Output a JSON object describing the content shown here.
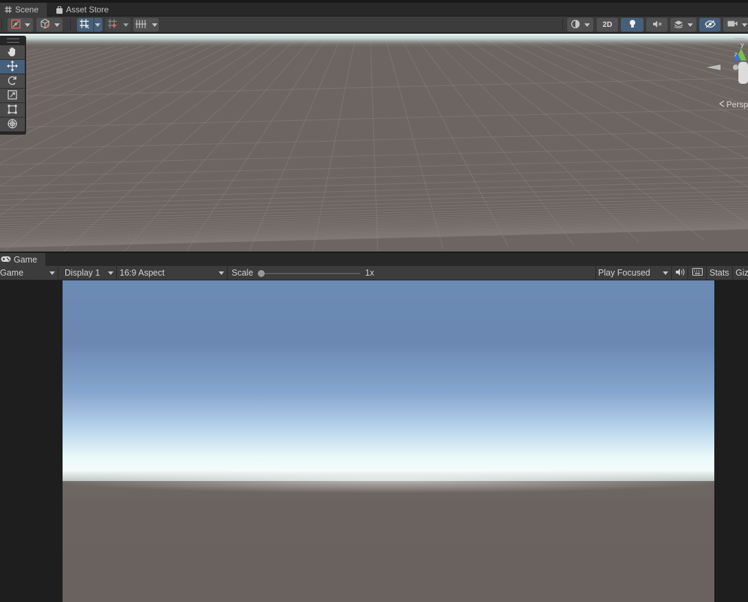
{
  "scene_tabs": [
    {
      "label": "Scene",
      "icon": "grid-icon"
    },
    {
      "label": "Asset Store",
      "icon": "shopping-bag-icon"
    }
  ],
  "scene_toolbar": {
    "toggle_2d_label": "2D"
  },
  "scene_view": {
    "projection_label": "Persp",
    "gizmo_axis_label": "y",
    "gizmo_axis_z_label": "z"
  },
  "tools": [
    {
      "name": "hand-tool",
      "icon": "hand-icon"
    },
    {
      "name": "move-tool",
      "icon": "move-arrows-icon",
      "active": true
    },
    {
      "name": "rotate-tool",
      "icon": "rotate-icon"
    },
    {
      "name": "scale-tool",
      "icon": "scale-icon"
    },
    {
      "name": "rect-tool",
      "icon": "rect-icon"
    },
    {
      "name": "transform-tool",
      "icon": "transform-icon"
    }
  ],
  "game_tab": {
    "label": "Game",
    "icon": "gamepad-icon"
  },
  "game_toolbar": {
    "view_select": "Game",
    "display_select": "Display 1",
    "aspect_select": "16:9 Aspect",
    "scale_label": "Scale",
    "scale_value": "1x",
    "scale_fraction": 0,
    "play_mode_select": "Play Focused",
    "stats_label": "Stats",
    "gizmos_label": "Gizmos"
  },
  "colors": {
    "accent_blue": "#46607c",
    "panel": "#3c3c3c",
    "tabbar": "#282828",
    "ground": "#6e6662",
    "sky_top": "#6b8ab4",
    "horizon": "#f4fcfa"
  }
}
